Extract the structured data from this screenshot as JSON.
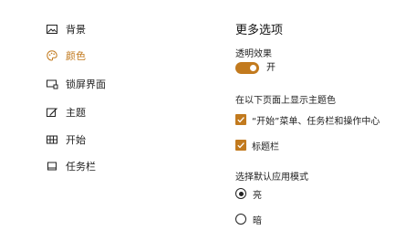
{
  "sidebar": {
    "items": [
      {
        "label": "背景",
        "icon": "picture-icon",
        "active": false
      },
      {
        "label": "颜色",
        "icon": "palette-icon",
        "active": true
      },
      {
        "label": "锁屏界面",
        "icon": "lock-screen-icon",
        "active": false
      },
      {
        "label": "主题",
        "icon": "theme-brush-icon",
        "active": false
      },
      {
        "label": "开始",
        "icon": "start-tiles-icon",
        "active": false
      },
      {
        "label": "任务栏",
        "icon": "taskbar-icon",
        "active": false
      }
    ]
  },
  "main": {
    "title": "更多选项",
    "transparency": {
      "label": "透明效果",
      "state_label": "开",
      "on": true
    },
    "accent_surfaces": {
      "label": "在以下页面上显示主题色",
      "options": [
        {
          "label": "“开始”菜单、任务栏和操作中心",
          "checked": true
        },
        {
          "label": "标题栏",
          "checked": true
        }
      ]
    },
    "app_mode": {
      "label": "选择默认应用模式",
      "options": [
        {
          "label": "亮",
          "selected": true
        },
        {
          "label": "暗",
          "selected": false
        }
      ]
    }
  },
  "colors": {
    "accent": "#c27a1e",
    "text": "#222222",
    "background": "#ffffff"
  }
}
